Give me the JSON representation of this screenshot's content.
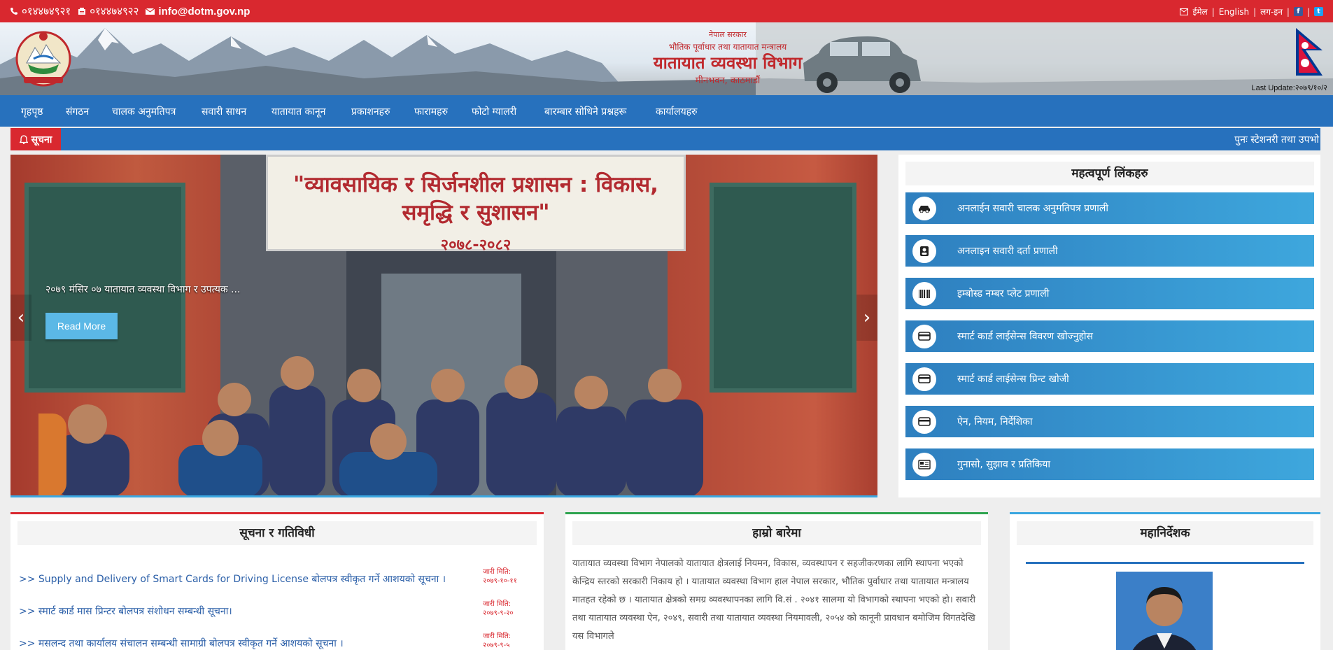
{
  "topbar": {
    "phone": "०१४४७४९२१",
    "fax": "०१४४७४९२२",
    "email": "info@dotm.gov.np",
    "email_link": "ईमेल",
    "english": "English",
    "login": "लग-इन",
    "facebook": "f",
    "twitter": "t"
  },
  "banner": {
    "line1": "नेपाल सरकार",
    "line2": "भौतिक पूर्वाधार तथा यातायात मन्त्रालय",
    "line3": "यातायात व्यवस्था विभाग",
    "line4": "मीनभवन, काठमाडौं",
    "last_update": "Last Update:२०७९/१०/२"
  },
  "nav": [
    "गृहपृष्ठ",
    "संगठन",
    "चालक अनुमतिपत्र",
    "सवारी साधन",
    "यातायात कानून",
    "प्रकाशनहरु",
    "फारामहरु",
    "फोटो ग्यालरी",
    "बारम्बार सोधिने प्रश्नहरू",
    "कार्यालयहरु"
  ],
  "notice": {
    "label": "सूचना",
    "ticker": "पुनः स्टेशनरी तथा उपभो"
  },
  "slider": {
    "sign_line1": "\"व्यावसायिक र सिर्जनशील प्रशासन : विकास, समृद्धि र सुशासन\"",
    "sign_line2": "२०७८-२०८२",
    "caption": "२०७९ मंसिर ०७ यातायात व्यवस्था विभाग र उपत्यक ...",
    "read_more": "Read More"
  },
  "important_links": {
    "title": "महत्वपूर्ण लिंकहरु",
    "items": [
      {
        "label": "अनलाईन सवारी चालक अनुमतिपत्र प्रणाली",
        "icon": "car-icon"
      },
      {
        "label": "अनलाइन सवारी दर्ता प्रणाली",
        "icon": "id-card-icon"
      },
      {
        "label": "इम्बोस्ड नम्बर प्लेट प्रणाली",
        "icon": "barcode-icon"
      },
      {
        "label": "स्मार्ट कार्ड लाईसेन्स विवरण खोज्नुहोस",
        "icon": "credit-card-icon"
      },
      {
        "label": "स्मार्ट कार्ड लाईसेन्स प्रिन्ट खोजी",
        "icon": "credit-card-icon"
      },
      {
        "label": "ऐन, नियम, निर्देशिका",
        "icon": "credit-card-icon"
      },
      {
        "label": "गुनासो, सुझाव र प्रतिकिया",
        "icon": "newspaper-icon"
      }
    ]
  },
  "news_panel": {
    "title": "सूचना र गतिविधी",
    "items": [
      {
        "text": ">> Supply and Delivery of Smart Cards for Driving License बोलपत्र स्वीकृत गर्ने आशयको सूचना ।",
        "date_label": "जारी मिति:",
        "date": "२०७९-१०-११"
      },
      {
        "text": ">> स्मार्ट कार्ड मास प्रिन्टर बोलपत्र संशोधन सम्बन्धी सूचना।",
        "date_label": "जारी मिति:",
        "date": "२०७९-९-२०"
      },
      {
        "text": ">> मसलन्द तथा कार्यालय संचालन सम्बन्धी सामाग्री बोलपत्र स्वीकृत गर्ने आशयको सूचना ।",
        "date_label": "जारी मिति:",
        "date": "२०७९-९-५"
      }
    ]
  },
  "about_panel": {
    "title": "हाम्रो बारेमा",
    "body": "यातायात व्यवस्था विभाग नेपालको यातायात क्षेत्रलाई नियमन, विकास, व्यवस्थापन र सहजीकरणका लागि स्थापना भएको केन्द्रिय स्तरको सरकारी निकाय हो । यातायात व्यवस्था विभाग हाल नेपाल सरकार, भौतिक पुर्वाधार तथा यातायात मन्त्रालय मातहत रहेको छ । यातायात क्षेत्रको समग्र व्यवस्थापनका लागि वि.सं . २०४१ सालमा यो विभागको स्थापना भएको हो। सवारी तथा यातायात व्यवस्था ऐन, २०४९, सवारी तथा यातायात व्यवस्था नियमावली, २०५४ को कानूनी प्रावधान बमोजिम विगतदेखि यस विभागले"
  },
  "dg_panel": {
    "title": "महानिर्देशक"
  }
}
